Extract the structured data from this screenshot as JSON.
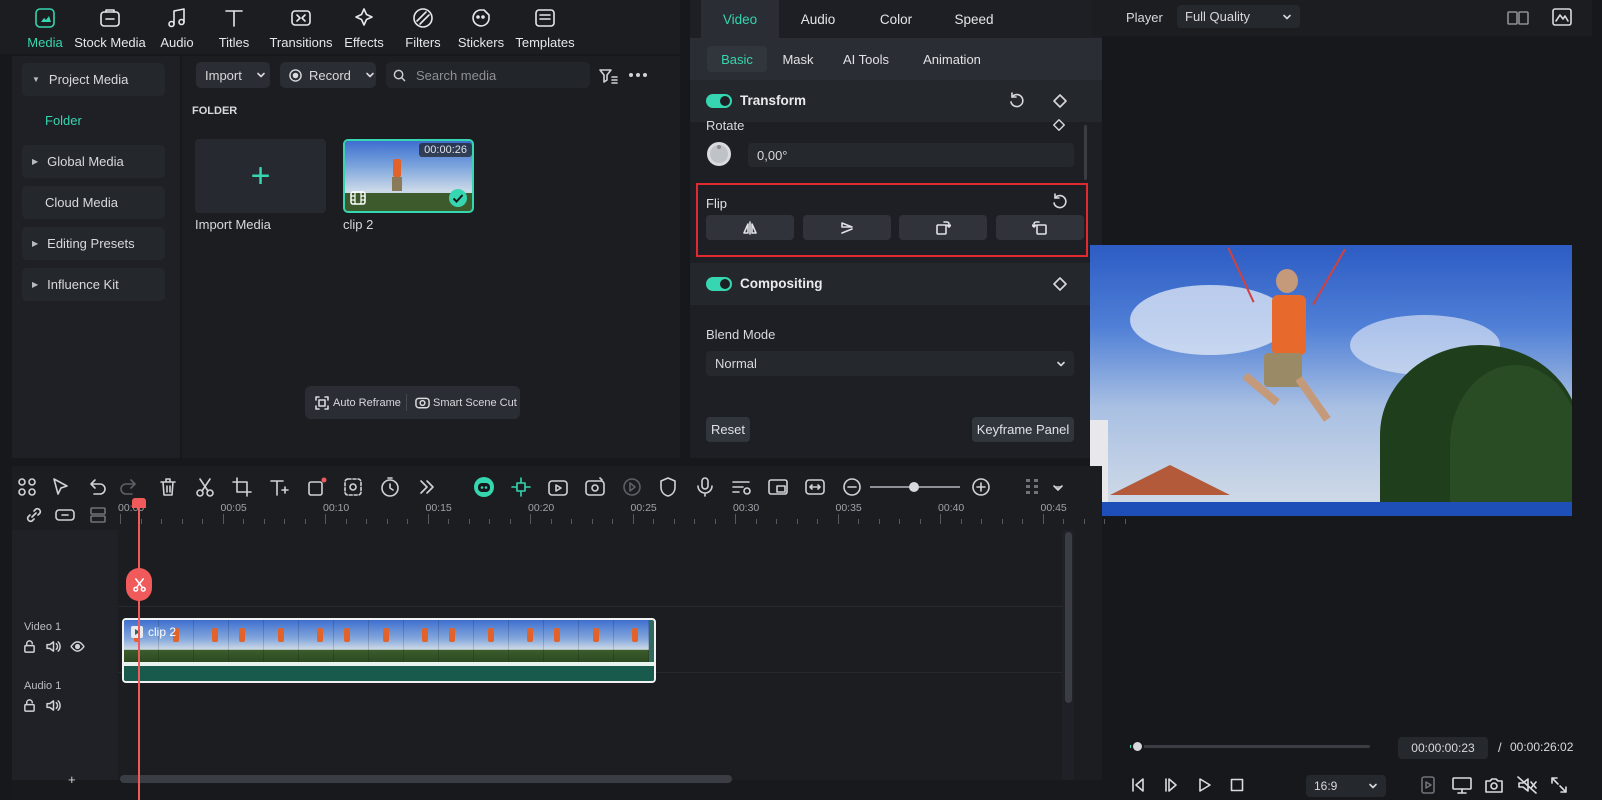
{
  "top_tabs": [
    {
      "label": "Media",
      "icon": "media-icon",
      "active": true
    },
    {
      "label": "Stock Media",
      "icon": "stock-media-icon"
    },
    {
      "label": "Audio",
      "icon": "music-note-icon"
    },
    {
      "label": "Titles",
      "icon": "title-t-icon"
    },
    {
      "label": "Transitions",
      "icon": "transitions-icon"
    },
    {
      "label": "Effects",
      "icon": "effects-sparkle-icon"
    },
    {
      "label": "Filters",
      "icon": "filters-icon"
    },
    {
      "label": "Stickers",
      "icon": "stickers-icon"
    },
    {
      "label": "Templates",
      "icon": "templates-icon"
    }
  ],
  "sidebar": {
    "items": [
      {
        "label": "Project Media",
        "expandable": true
      },
      {
        "label": "Folder",
        "selected": true
      },
      {
        "label": "Global Media",
        "expandable": true
      },
      {
        "label": "Cloud Media"
      },
      {
        "label": "Editing Presets",
        "expandable": true
      },
      {
        "label": "Influence Kit",
        "expandable": true
      }
    ]
  },
  "browser": {
    "import_label": "Import",
    "record_label": "Record",
    "search_placeholder": "Search media",
    "folder_heading": "FOLDER",
    "import_media_label": "Import Media",
    "clip": {
      "name": "clip 2",
      "duration": "00:00:26"
    },
    "auto_reframe_label": "Auto Reframe",
    "smart_scene_cut_label": "Smart Scene Cut"
  },
  "props": {
    "tabs": [
      "Video",
      "Audio",
      "Color",
      "Speed"
    ],
    "active_tab": "Video",
    "subtabs": [
      "Basic",
      "Mask",
      "AI Tools",
      "Animation"
    ],
    "active_subtab": "Basic",
    "transform_label": "Transform",
    "rotate_label": "Rotate",
    "rotate_value": "0,00°",
    "flip_label": "Flip",
    "compositing_label": "Compositing",
    "blend_mode_label": "Blend Mode",
    "blend_mode_value": "Normal",
    "reset_label": "Reset",
    "keyframe_panel_label": "Keyframe Panel",
    "highlight_color": "#e02a2f"
  },
  "player": {
    "label": "Player",
    "quality": "Full Quality",
    "current_time": "00:00:00:23",
    "separator": "/",
    "total_time": "00:00:26:02",
    "aspect": "16:9"
  },
  "timeline": {
    "ruler": [
      "00:00",
      "00:05",
      "00:10",
      "00:15",
      "00:20",
      "00:25",
      "00:30",
      "00:35",
      "00:40",
      "00:45"
    ],
    "tracks": [
      {
        "label": "Video 1"
      },
      {
        "label": "Audio 1"
      }
    ],
    "clip_label": "clip 2",
    "add_track": "+"
  },
  "colors": {
    "accent": "#35d6b0",
    "playhead": "#f05a5a",
    "background": "#16181c"
  }
}
